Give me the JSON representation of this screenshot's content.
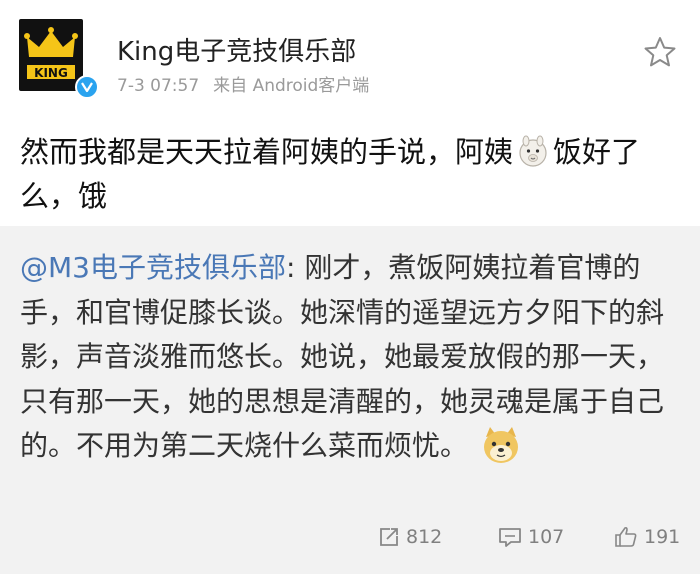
{
  "post": {
    "author": "King电子竞技俱乐部",
    "avatar_text": "KING",
    "timestamp": "7-3 07:57",
    "source": "来自 Android客户端",
    "text_before_emoji": "然而我都是天天拉着阿姨的手说，阿姨",
    "text_after_emoji": "饭好了么，饿"
  },
  "retweet": {
    "mention": "@M3电子竞技俱乐部",
    "text": ": 刚才，煮饭阿姨拉着官博的手，和官博促膝长谈。她深情的遥望远方夕阳下的斜影，声音淡雅而悠长。她说，她最爱放假的那一天，只有那一天，她的思想是清醒的，她灵魂是属于自己的。不用为第二天烧什么菜而烦忧。"
  },
  "actions": {
    "share_count": "812",
    "comment_count": "107",
    "like_count": "191"
  },
  "colors": {
    "mention": "#4a78b6",
    "verified": "#2aa3ef",
    "card_bg": "#ffffff",
    "retweet_bg": "#f2f2f2"
  },
  "icons": [
    "star-icon",
    "verified-icon",
    "alpaca-emoji-icon",
    "doge-emoji-icon",
    "share-icon",
    "comment-icon",
    "like-icon"
  ]
}
